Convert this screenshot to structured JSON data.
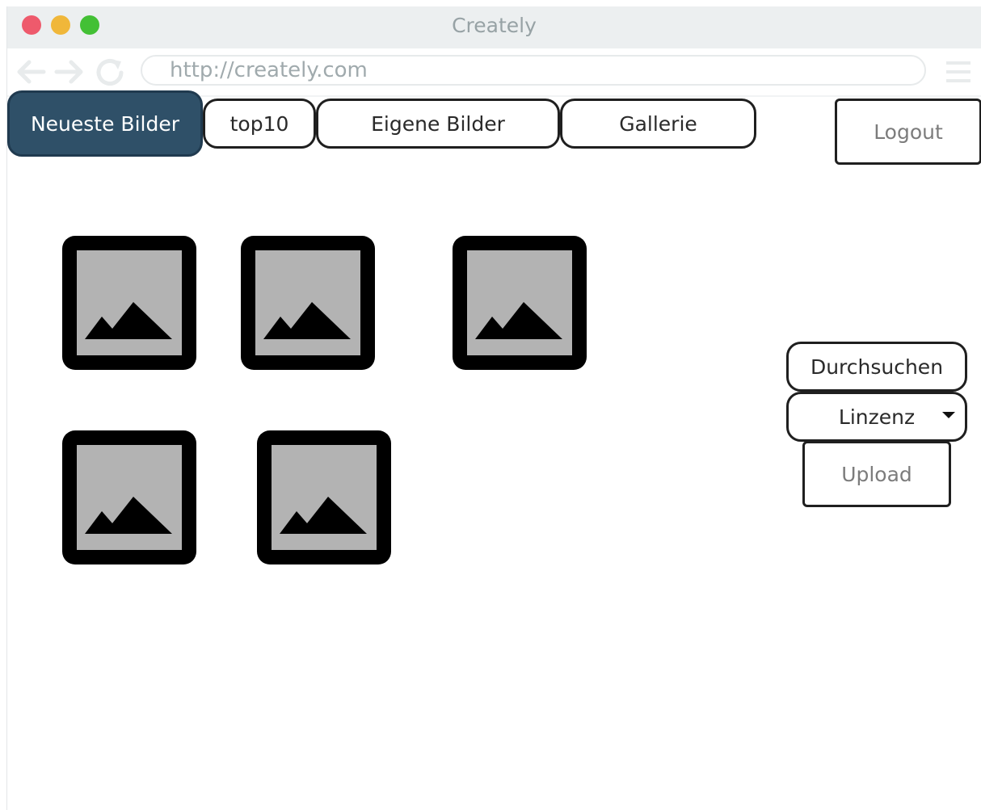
{
  "window": {
    "title": "Creately",
    "traffic_lights": {
      "close": "#ee5a6c",
      "minimize": "#f0b73a",
      "zoom": "#43c035"
    }
  },
  "browser": {
    "url": "http://creately.com",
    "icons": [
      "back-arrow-icon",
      "forward-arrow-icon",
      "reload-icon",
      "menu-icon"
    ]
  },
  "nav": {
    "tabs": [
      {
        "label": "Neueste Bilder",
        "active": true
      },
      {
        "label": "top10",
        "active": false
      },
      {
        "label": "Eigene Bilder",
        "active": false
      },
      {
        "label": "Gallerie",
        "active": false
      }
    ],
    "logout": "Logout"
  },
  "images": [
    {
      "icon": "image-placeholder-icon"
    },
    {
      "icon": "image-placeholder-icon"
    },
    {
      "icon": "image-placeholder-icon"
    },
    {
      "icon": "image-placeholder-icon"
    },
    {
      "icon": "image-placeholder-icon"
    }
  ],
  "upload_panel": {
    "browse": "Durchsuchen",
    "license": "Linzenz",
    "upload": "Upload"
  },
  "colors": {
    "active_tab": "#2f5068",
    "thumbnail_frame": "#000000",
    "thumbnail_fill": "#b3b3b3"
  }
}
